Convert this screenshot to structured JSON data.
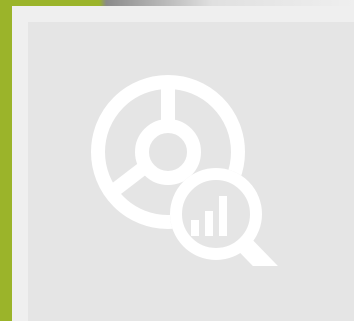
{
  "colors": {
    "accent": "#9bb42a",
    "frame": "#efefef",
    "panel": "#e5e5e5",
    "icon": "#ffffff",
    "strip_start": "#9bb42a",
    "strip_end": "#e0e0e0"
  },
  "icons": {
    "illustration": "analytics-magnifier-icon"
  }
}
